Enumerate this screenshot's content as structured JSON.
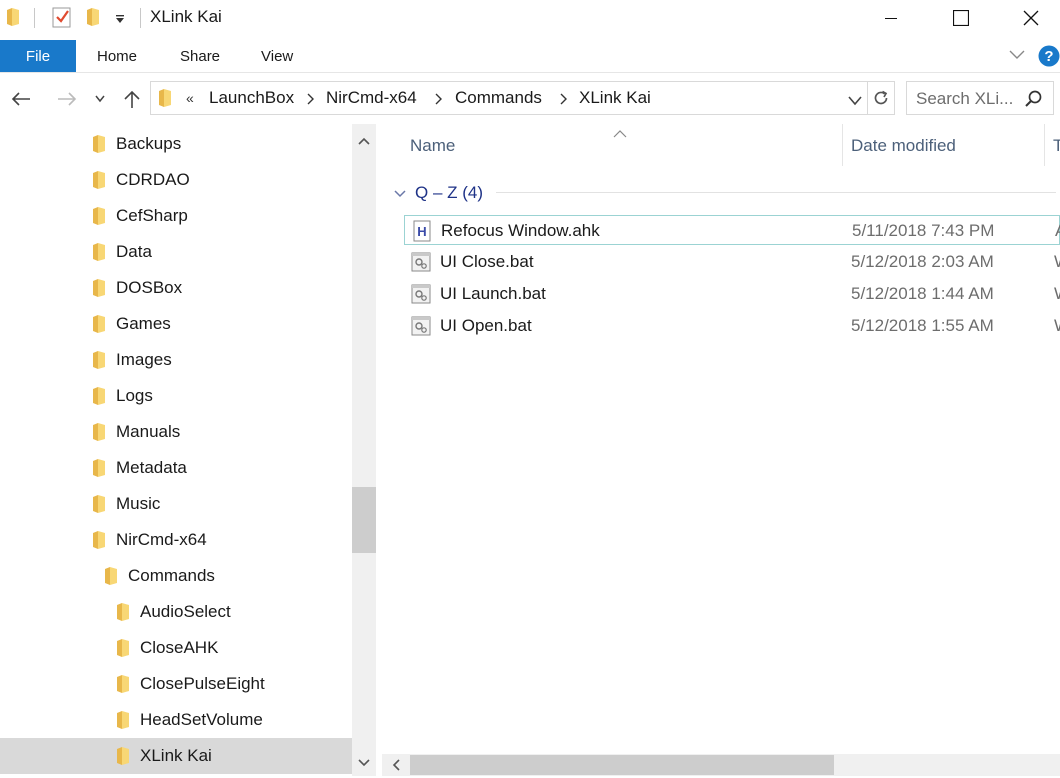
{
  "window": {
    "title": "XLink Kai",
    "minimize_icon": "minimize-icon",
    "maximize_icon": "maximize-icon",
    "close_icon": "close-icon"
  },
  "ribbon": {
    "file": "File",
    "tabs": [
      "Home",
      "Share",
      "View"
    ]
  },
  "address": {
    "overflow": "«",
    "crumbs": [
      "LaunchBox",
      "NirCmd-x64",
      "Commands",
      "XLink Kai"
    ],
    "search_placeholder": "Search XLi..."
  },
  "nav": {
    "items": [
      {
        "label": "Backups"
      },
      {
        "label": "CDRDAO"
      },
      {
        "label": "CefSharp"
      },
      {
        "label": "Data"
      },
      {
        "label": "DOSBox"
      },
      {
        "label": "Games"
      },
      {
        "label": "Images"
      },
      {
        "label": "Logs"
      },
      {
        "label": "Manuals"
      },
      {
        "label": "Metadata"
      },
      {
        "label": "Music"
      },
      {
        "label": "NirCmd-x64"
      },
      {
        "label": "Commands"
      },
      {
        "label": "AudioSelect"
      },
      {
        "label": "CloseAHK"
      },
      {
        "label": "ClosePulseEight"
      },
      {
        "label": "HeadSetVolume"
      },
      {
        "label": "XLink Kai"
      }
    ]
  },
  "columns": {
    "name": "Name",
    "date": "Date modified",
    "type": "T"
  },
  "group": {
    "label": "Q – Z (4)"
  },
  "files": [
    {
      "name": "Refocus Window.ahk",
      "date": "5/11/2018 7:43 PM",
      "type": "A",
      "icon": "ahk-file-icon"
    },
    {
      "name": "UI Close.bat",
      "date": "5/12/2018 2:03 AM",
      "type": "W",
      "icon": "bat-file-icon"
    },
    {
      "name": "UI Launch.bat",
      "date": "5/12/2018 1:44 AM",
      "type": "W",
      "icon": "bat-file-icon"
    },
    {
      "name": "UI Open.bat",
      "date": "5/12/2018 1:55 AM",
      "type": "W",
      "icon": "bat-file-icon"
    }
  ],
  "colors": {
    "accent": "#1979ca",
    "folder": "#f8d775",
    "selection": "#d9d9d9",
    "group_text": "#1e3287"
  }
}
